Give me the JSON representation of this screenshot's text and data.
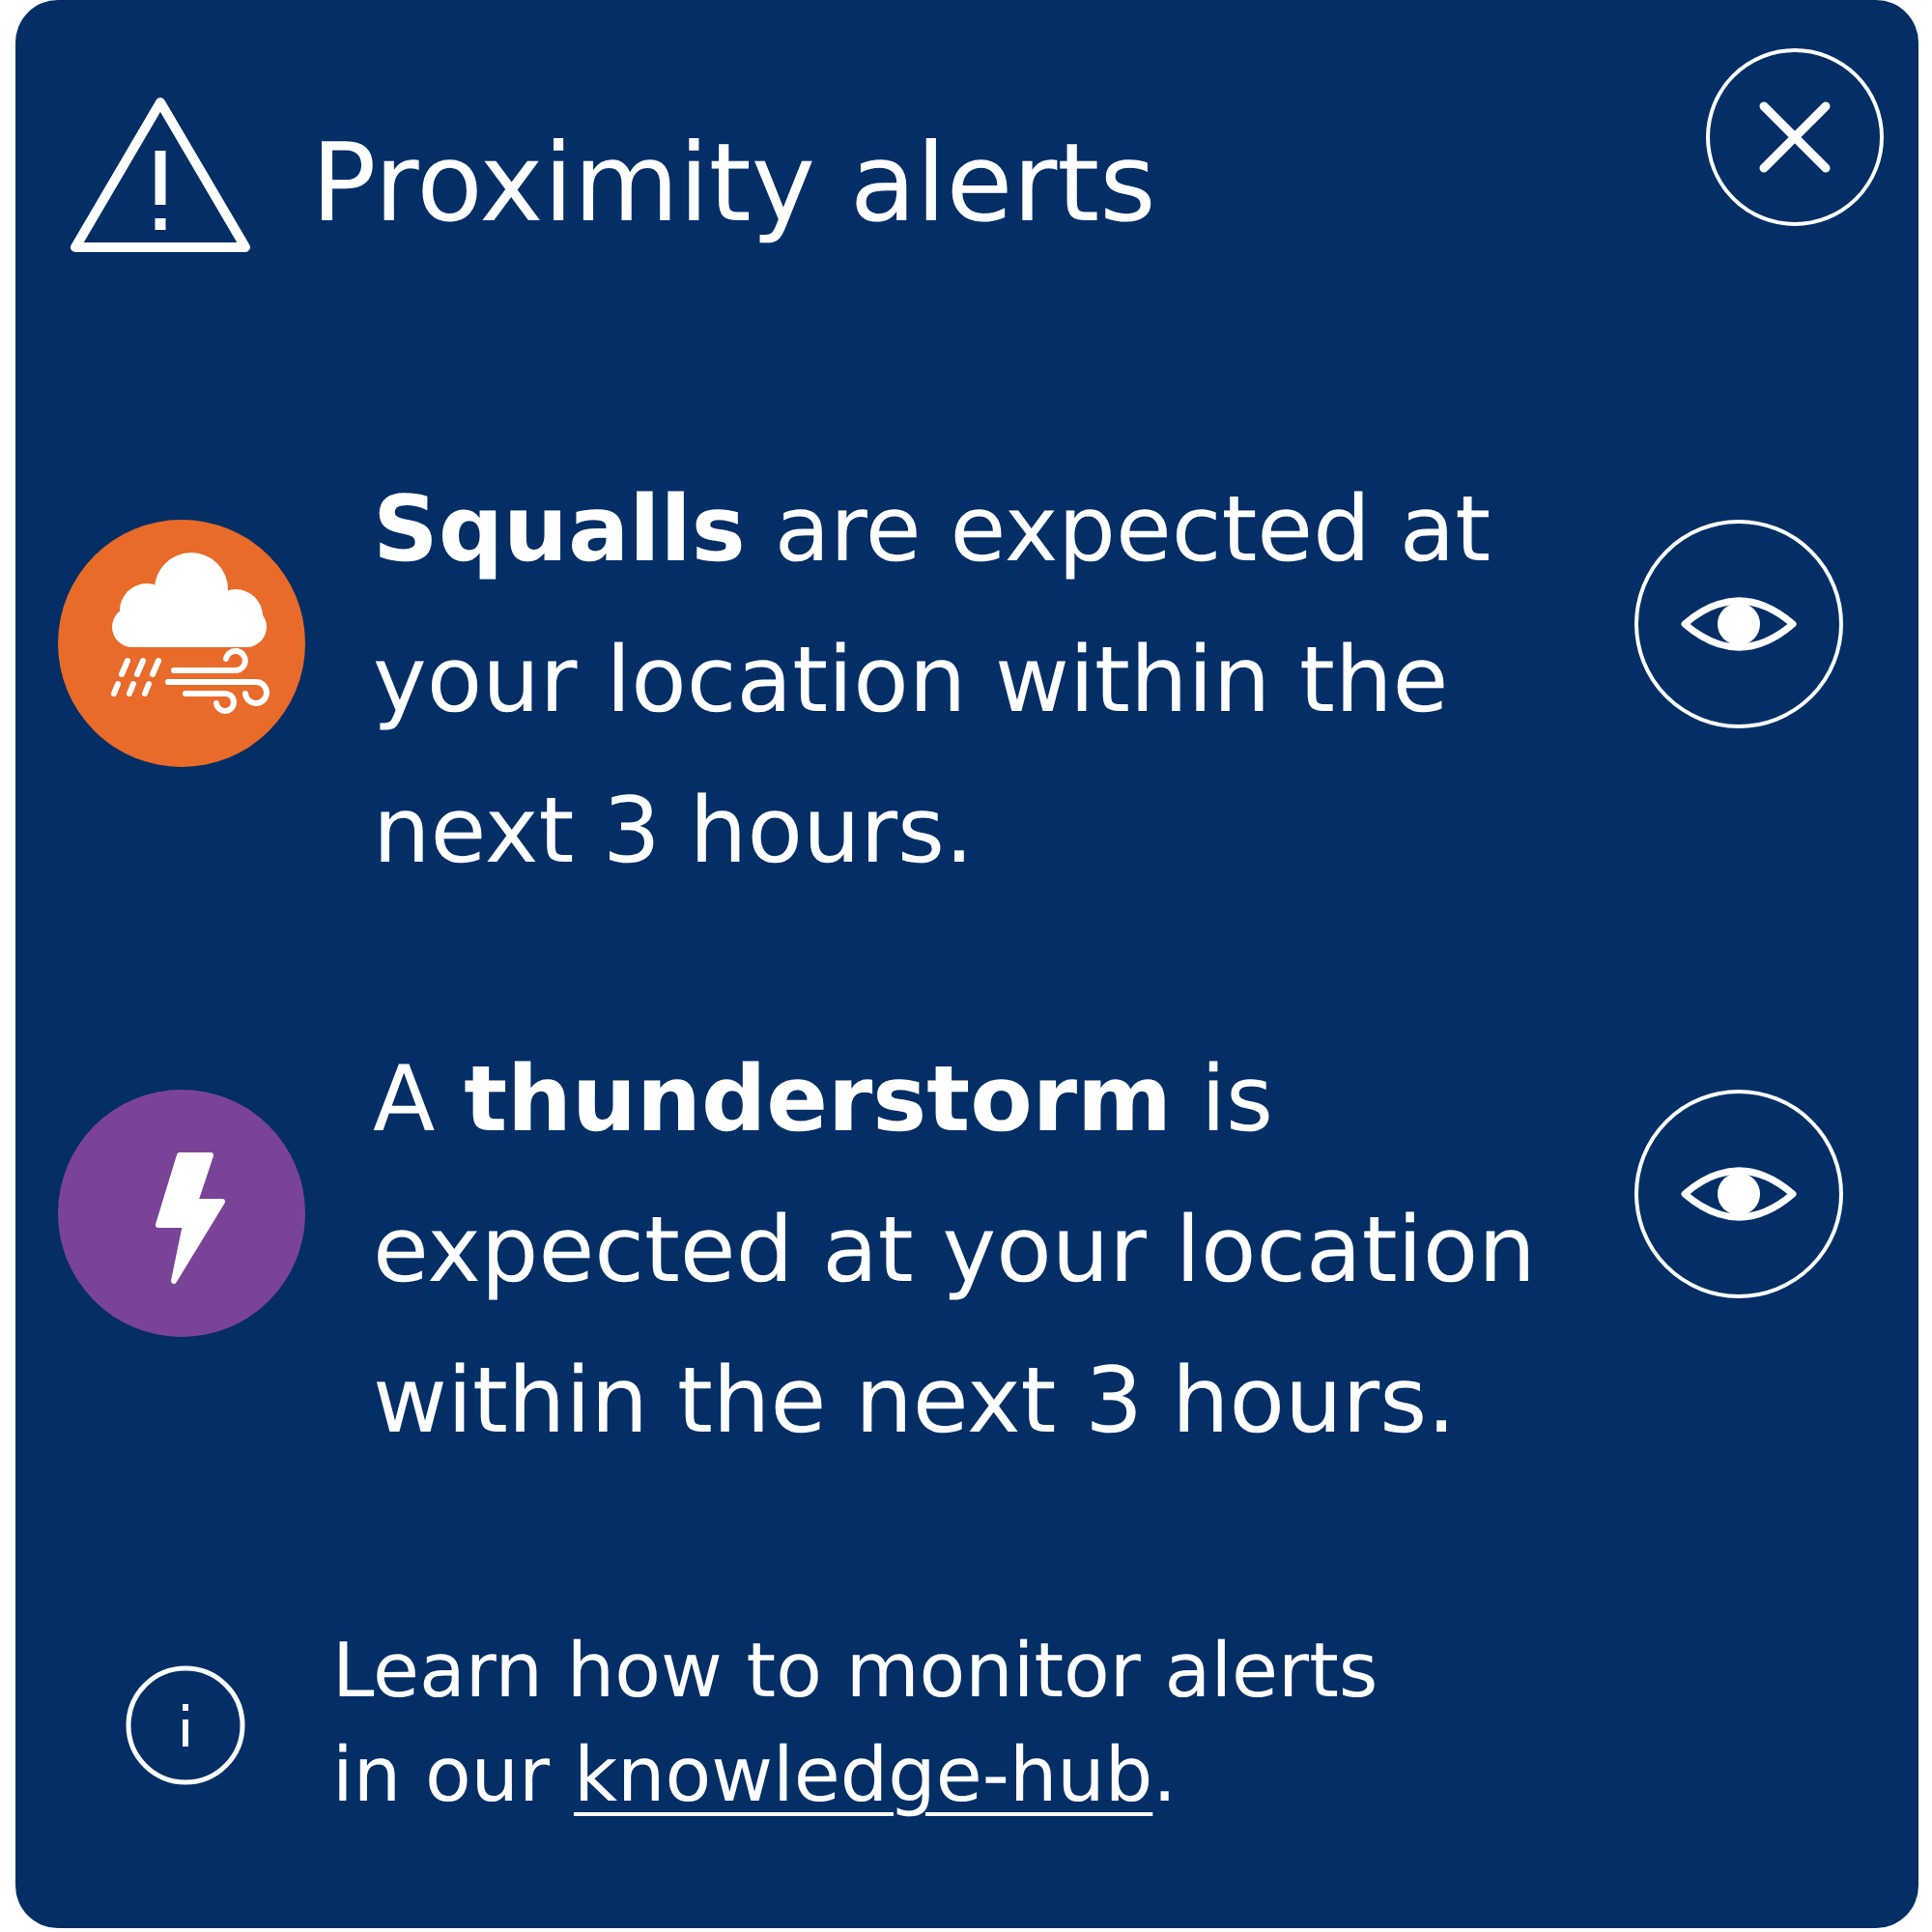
{
  "header": {
    "title": "Proximity alerts"
  },
  "alerts": [
    {
      "kind": "squalls",
      "color": "#e86b2a",
      "message": "**Squalls** are expected at your location within the next 3 hours."
    },
    {
      "kind": "thunderstorm",
      "color": "#7b4397",
      "message": "A **thunderstorm** is expected at your location within the next 3 hours."
    }
  ],
  "footer": {
    "text": "Learn how to monitor alerts in our",
    "link": "knowledge-hub",
    "after": "."
  }
}
